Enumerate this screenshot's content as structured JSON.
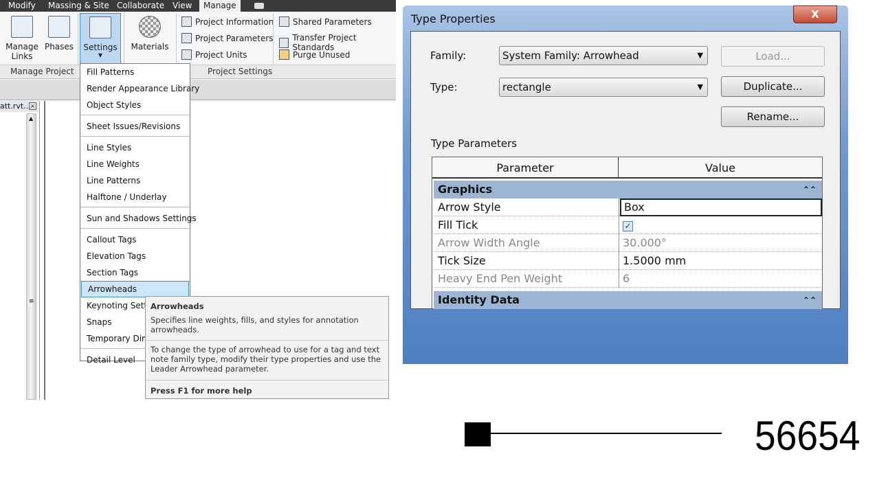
{
  "ribbon": {
    "tabs": [
      "Modify",
      "Massing & Site",
      "Collaborate",
      "View",
      "Manage"
    ],
    "active_tab": "Manage",
    "manage_project": {
      "label": "Manage Project",
      "buttons": [
        "Manage Links",
        "Phases"
      ]
    },
    "settings_label": "Settings",
    "materials_label": "Materials",
    "project_settings": {
      "label": "Project Settings",
      "items": [
        "Project Information",
        "Project Parameters",
        "Project Units",
        "Shared Parameters",
        "Transfer Project Standards",
        "Purge Unused"
      ]
    }
  },
  "browser": {
    "title": "att.rvt..."
  },
  "settings_menu": {
    "items": [
      "Fill Patterns",
      "Render Appearance Library",
      "Object Styles",
      "Sheet Issues/Revisions",
      "Line Styles",
      "Line Weights",
      "Line Patterns",
      "Halftone / Underlay",
      "Sun and Shadows Settings",
      "Callout Tags",
      "Elevation Tags",
      "Section Tags",
      "Arrowheads",
      "Keynoting Settings",
      "Snaps",
      "Temporary Dimensions",
      "Detail Level"
    ],
    "highlighted": "Arrowheads"
  },
  "tooltip": {
    "title": "Arrowheads",
    "summary": "Specifies line weights, fills, and styles for annotation arrowheads.",
    "detail": "To change the type of arrowhead to use for a tag and text note family type, modify their type properties and use the Leader Arrowhead parameter.",
    "help": "Press F1 for more help"
  },
  "dialog": {
    "title": "Type Properties",
    "close": "X",
    "family_label": "Family:",
    "family_value": "System Family: Arrowhead",
    "type_label": "Type:",
    "type_value": "rectangle",
    "load": "Load...",
    "duplicate": "Duplicate...",
    "rename": "Rename...",
    "type_parameters": "Type Parameters",
    "columns": [
      "Parameter",
      "Value"
    ],
    "groups": [
      "Graphics",
      "Identity Data"
    ],
    "rows": [
      {
        "param": "Arrow Style",
        "value": "Box"
      },
      {
        "param": "Fill Tick",
        "value": "checked"
      },
      {
        "param": "Arrow Width Angle",
        "value": "30.000°"
      },
      {
        "param": "Tick Size",
        "value": "1.5000 mm"
      },
      {
        "param": "Heavy End Pen Weight",
        "value": "6"
      }
    ]
  },
  "sample": {
    "number": "56654"
  }
}
